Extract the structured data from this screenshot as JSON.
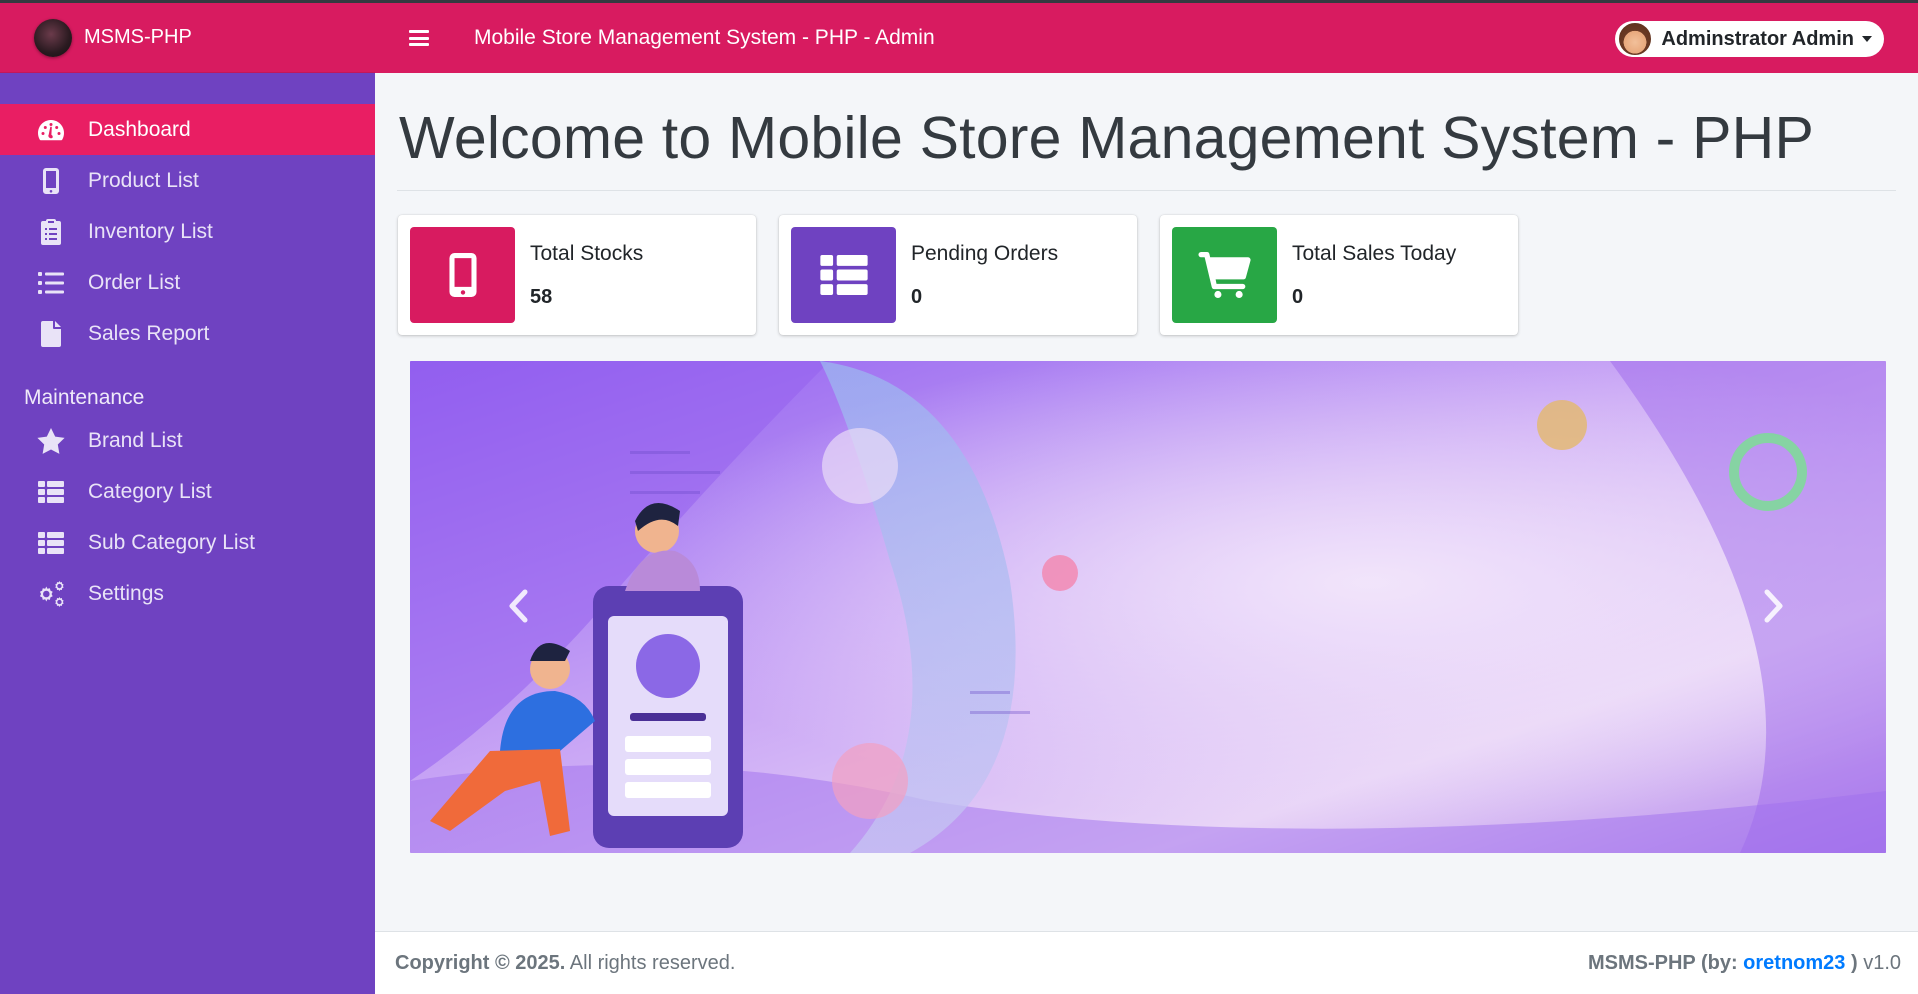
{
  "app": {
    "brand": "MSMS-PHP",
    "navbar_title": "Mobile Store Management System - PHP - Admin"
  },
  "user": {
    "name": "Adminstrator Admin"
  },
  "sidebar": {
    "items": [
      {
        "label": "Dashboard",
        "icon": "tachometer-icon",
        "active": true
      },
      {
        "label": "Product List",
        "icon": "mobile-icon"
      },
      {
        "label": "Inventory List",
        "icon": "clipboard-icon"
      },
      {
        "label": "Order List",
        "icon": "list-icon"
      },
      {
        "label": "Sales Report",
        "icon": "file-icon"
      }
    ],
    "maintenance_header": "Maintenance",
    "maintenance_items": [
      {
        "label": "Brand List",
        "icon": "star-icon"
      },
      {
        "label": "Category List",
        "icon": "th-list-icon"
      },
      {
        "label": "Sub Category List",
        "icon": "th-list-icon"
      },
      {
        "label": "Settings",
        "icon": "cogs-icon"
      }
    ]
  },
  "main": {
    "title": "Welcome to Mobile Store Management System - PHP",
    "info_boxes": [
      {
        "label": "Total Stocks",
        "value": "58",
        "color": "#d81b60",
        "icon": "mobile-icon"
      },
      {
        "label": "Pending Orders",
        "value": "0",
        "color": "#6f42c1",
        "icon": "th-list-icon"
      },
      {
        "label": "Total Sales Today",
        "value": "0",
        "color": "#28a745",
        "icon": "shopping-cart-icon"
      }
    ]
  },
  "footer": {
    "copyright": "Copyright © 2025.",
    "rights": " All rights reserved.",
    "credit_prefix": "MSMS-PHP (by: ",
    "credit_author": "oretnom23",
    "credit_suffix": " )",
    "version": " v1.0"
  },
  "colors": {
    "primary": "#d81b60",
    "sidebar": "#6f42c1",
    "active": "#e91e63",
    "success": "#28a745",
    "link": "#007bff"
  }
}
